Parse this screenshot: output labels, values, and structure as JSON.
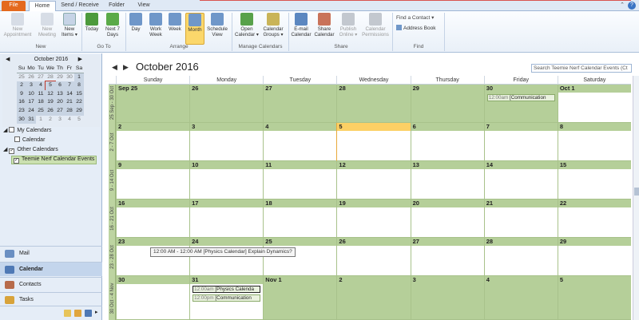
{
  "tabs": {
    "file": "File",
    "home": "Home",
    "send": "Send / Receive",
    "folder": "Folder",
    "view": "View"
  },
  "ribbon": {
    "new_appointment": "New\nAppointment",
    "new_meeting": "New\nMeeting",
    "new_items": "New\nItems ▾",
    "group_new": "New",
    "today": "Today",
    "next7": "Next 7\nDays",
    "group_goto": "Go To",
    "day": "Day",
    "work_week": "Work\nWeek",
    "week": "Week",
    "month": "Month",
    "schedule_view": "Schedule\nView",
    "group_arrange": "Arrange",
    "open_calendar": "Open\nCalendar ▾",
    "calendar_groups": "Calendar\nGroups ▾",
    "group_manage": "Manage Calendars",
    "email_calendar": "E-mail\nCalendar",
    "share_calendar": "Share\nCalendar",
    "publish_online": "Publish\nOnline ▾",
    "calendar_permissions": "Calendar\nPermissions",
    "group_share": "Share",
    "find_contact": "Find a Contact ▾",
    "address_book": "Address Book",
    "group_find": "Find"
  },
  "mini_calendar": {
    "title": "October 2016",
    "headers": [
      "Su",
      "Mo",
      "Tu",
      "We",
      "Th",
      "Fr",
      "Sa"
    ],
    "weeks": [
      [
        "25",
        "26",
        "27",
        "28",
        "29",
        "30",
        "1"
      ],
      [
        "2",
        "3",
        "4",
        "5",
        "6",
        "7",
        "8"
      ],
      [
        "9",
        "10",
        "11",
        "12",
        "13",
        "14",
        "15"
      ],
      [
        "16",
        "17",
        "18",
        "19",
        "20",
        "21",
        "22"
      ],
      [
        "23",
        "24",
        "25",
        "26",
        "27",
        "28",
        "29"
      ],
      [
        "30",
        "31",
        "1",
        "2",
        "3",
        "4",
        "5"
      ]
    ]
  },
  "calendars": {
    "my_calendars": "My Calendars",
    "calendar": "Calendar",
    "other_calendars": "Other Calendars",
    "teemie": "Teemie Nerf Calendar Events"
  },
  "nav": {
    "mail": "Mail",
    "calendar": "Calendar",
    "contacts": "Contacts",
    "tasks": "Tasks"
  },
  "main": {
    "title": "October 2016",
    "search_placeholder": "Search Teemie Nerf Calendar Events (Ct",
    "day_headers": [
      "Sunday",
      "Monday",
      "Tuesday",
      "Wednesday",
      "Thursday",
      "Friday",
      "Saturday"
    ],
    "week_labels": [
      "25 Sep - 30 Oct",
      "2 - 7 Oct",
      "9 - 14 Oct",
      "16 - 21 Oct",
      "23 - 28 Oct",
      "30 Oct - 4 Nov"
    ],
    "weeks": [
      [
        "Sep 25",
        "26",
        "27",
        "28",
        "29",
        "30",
        "Oct 1"
      ],
      [
        "2",
        "3",
        "4",
        "5",
        "6",
        "7",
        "8"
      ],
      [
        "9",
        "10",
        "11",
        "12",
        "13",
        "14",
        "15"
      ],
      [
        "16",
        "17",
        "18",
        "19",
        "20",
        "21",
        "22"
      ],
      [
        "23",
        "24",
        "25",
        "26",
        "27",
        "28",
        "29"
      ],
      [
        "30",
        "31",
        "Nov 1",
        "2",
        "3",
        "4",
        "5"
      ]
    ]
  },
  "events": {
    "e1_time": "12:00am",
    "e1_title": "[Communication",
    "e2_time": "12:00am",
    "e2_title": "[Physics Calenda",
    "e3_time": "12:00pm",
    "e3_title": "[Communication"
  },
  "tooltip": "12:00 AM - 12:00 AM [Physics Calendar] Explain Dynamics?",
  "colors": {
    "accent": "#e4691e",
    "week_bg": "#b5cf99",
    "today": "#fcd065",
    "ribbon_sel": "#fbd76b"
  }
}
